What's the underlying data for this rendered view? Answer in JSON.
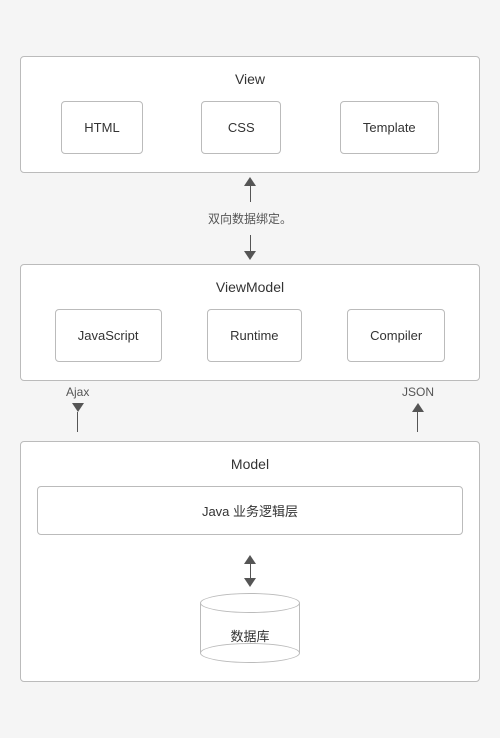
{
  "view": {
    "label": "View",
    "items": [
      "HTML",
      "CSS",
      "Template"
    ]
  },
  "connector1": {
    "label": "双向数据绑定。"
  },
  "viewmodel": {
    "label": "ViewModel",
    "items": [
      "JavaScript",
      "Runtime",
      "Compiler"
    ]
  },
  "connector2": {
    "left_label": "Ajax",
    "right_label": "JSON"
  },
  "model": {
    "label": "Model",
    "java_label": "Java 业务逻辑层",
    "db_label": "数据库"
  }
}
